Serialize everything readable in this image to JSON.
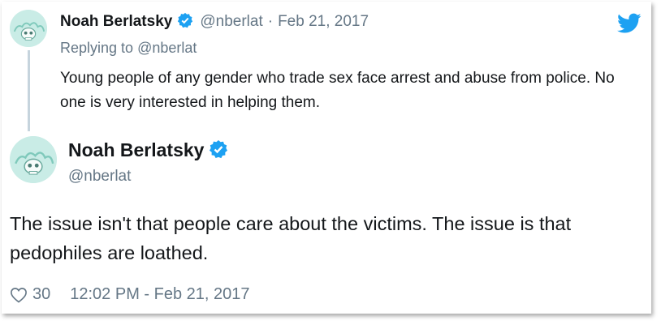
{
  "colors": {
    "twitter_blue": "#1da1f2",
    "verified_blue": "#1da1f2",
    "secondary_text": "#657786",
    "primary_text": "#14171a",
    "avatar_bg": "#c9ece6"
  },
  "parent_tweet": {
    "display_name": "Noah Berlatsky",
    "handle": "@nberlat",
    "separator": "·",
    "date": "Feb 21, 2017",
    "reply_prefix": "Replying to ",
    "reply_to": "@nberlat",
    "text": "Young people of any gender who trade sex face arrest and abuse from police. No one is very interested in helping them."
  },
  "main_tweet": {
    "display_name": "Noah Berlatsky",
    "handle": "@nberlat",
    "text": "The issue isn't that people care about the victims. The issue is that pedophiles are loathed.",
    "likes": "30",
    "timestamp": "12:02 PM - Feb 21, 2017"
  },
  "icons": {
    "logo": "twitter-bird-icon",
    "verified": "verified-badge-icon",
    "like": "heart-icon",
    "avatar": "skull-avatar"
  }
}
